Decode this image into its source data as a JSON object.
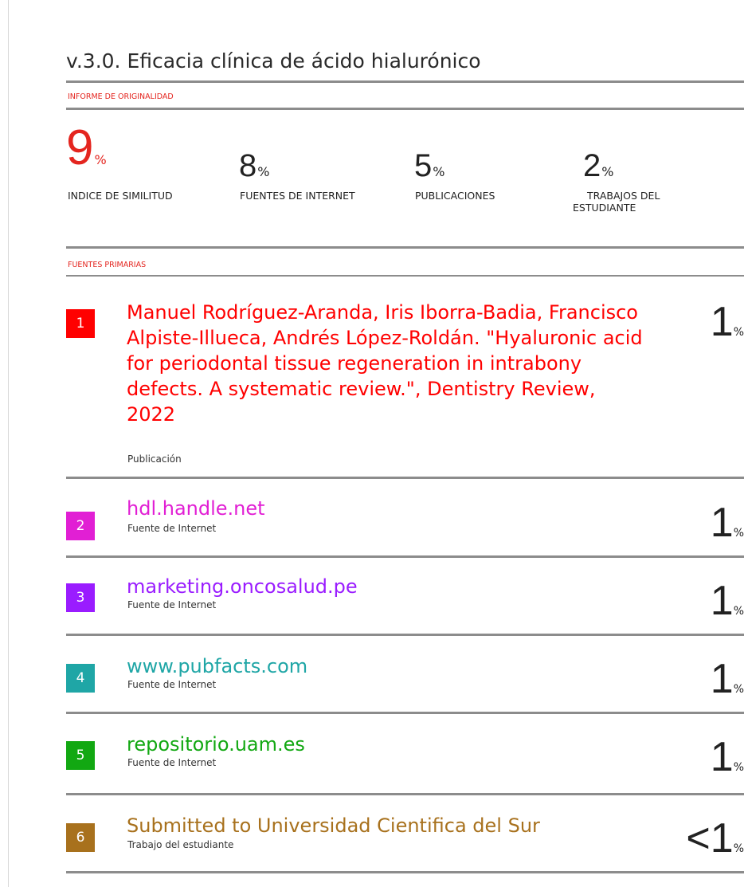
{
  "report": {
    "title": "v.3.0. Eficacia clínica de ácido hialurónico",
    "originality_label": "INFORME DE ORIGINALIDAD",
    "primary_sources_label": "FUENTES PRIMARIAS"
  },
  "stats": [
    {
      "value": "9",
      "unit": "%",
      "label_line1": "INDICE DE SIMILITUD",
      "label_line2": "",
      "color": "#e4251f"
    },
    {
      "value": "8",
      "unit": "%",
      "label_line1": "FUENTES DE INTERNET",
      "label_line2": "",
      "color": "#222222"
    },
    {
      "value": "5",
      "unit": "%",
      "label_line1": "PUBLICACIONES",
      "label_line2": "",
      "color": "#222222"
    },
    {
      "value": "2",
      "unit": "%",
      "label_line1": "TRABAJOS DEL",
      "label_line2": "ESTUDIANTE",
      "color": "#222222"
    }
  ],
  "sources": [
    {
      "number": "1",
      "title": "Manuel Rodríguez-Aranda, Iris Iborra-Badia, Francisco Alpiste-Illueca, Andrés López-Roldán. \"Hyaluronic acid for periodontal tissue regeneration in intrabony defects. A systematic review.\", Dentistry Review, 2022",
      "type": "Publicación",
      "percent": "1",
      "percent_symbol": "%",
      "color": "#ff0000"
    },
    {
      "number": "2",
      "title": "hdl.handle.net",
      "type": "Fuente de Internet",
      "percent": "1",
      "percent_symbol": "%",
      "color": "#e11fd4"
    },
    {
      "number": "3",
      "title": "marketing.oncosalud.pe",
      "type": "Fuente de Internet",
      "percent": "1",
      "percent_symbol": "%",
      "color": "#9a1cff"
    },
    {
      "number": "4",
      "title": "www.pubfacts.com",
      "type": "Fuente de Internet",
      "percent": "1",
      "percent_symbol": "%",
      "color": "#1fa6a6"
    },
    {
      "number": "5",
      "title": "repositorio.uam.es",
      "type": "Fuente de Internet",
      "percent": "1",
      "percent_symbol": "%",
      "color": "#12a812"
    },
    {
      "number": "6",
      "title": "Submitted to Universidad Cientifica del Sur",
      "type": "Trabajo del estudiante",
      "percent": "<1",
      "percent_symbol": "%",
      "color": "#a8711d"
    }
  ]
}
